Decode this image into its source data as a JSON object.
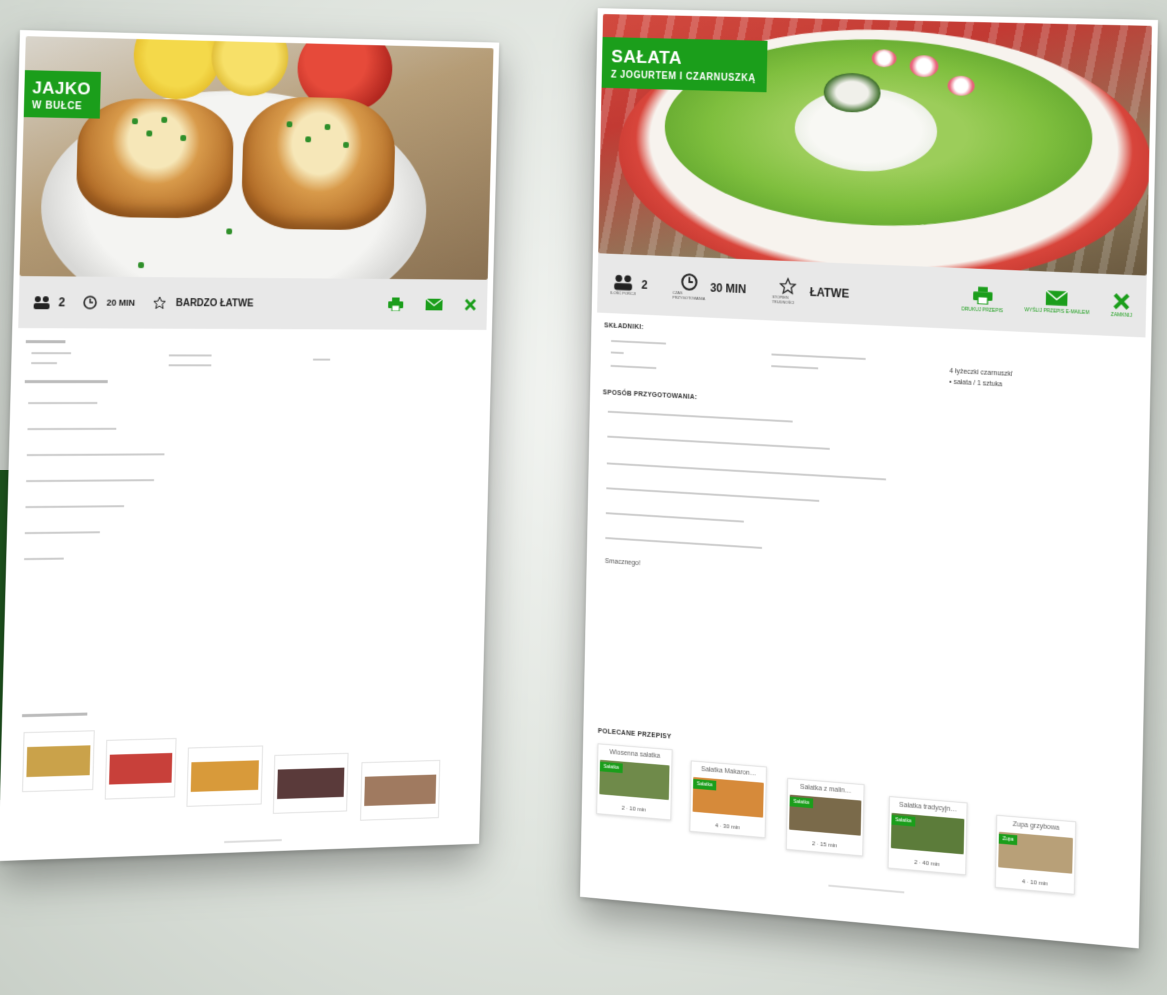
{
  "colors": {
    "accent": "#1b9e1b",
    "toolbar_bg": "#e8e8e8"
  },
  "left": {
    "title_line1": "JAJKO",
    "title_line2": "W BUŁCE",
    "servings": "2",
    "time": "20 MIN",
    "difficulty": "BARDZO ŁATWE"
  },
  "right": {
    "title_line1": "SAŁATA",
    "title_line2": "Z JOGURTEM I CZARNUSZKĄ",
    "servings": "2",
    "time": "30 MIN",
    "difficulty": "ŁATWE",
    "servings_caption": "ILOŚĆ PORCJI",
    "time_caption": "CZAS PRZYGOTOWANIA",
    "difficulty_caption": "STOPIEŃ TRUDNOŚCI",
    "actions": [
      "DRUKUJ PRZEPIS",
      "WYŚLIJ PRZEPIS E-MAILEM",
      "ZAMKNIJ"
    ],
    "ingredients_label": "SKŁADNIKI:",
    "ingredients_col3": [
      "4 łyżeczki czarnuszki",
      "• sałata / 1 sztuka"
    ],
    "method_label": "SPOSÓB PRZYGOTOWANIA:",
    "ending": "Smacznego!",
    "recommended_label": "POLECANE PRZEPISY",
    "recommended": [
      {
        "title": "Wiosenna sałatka",
        "badge": "Sałatka",
        "meta": "2 · 10 min",
        "color": "#6f8a4a"
      },
      {
        "title": "Sałatka Makaron…",
        "badge": "Sałatka",
        "meta": "4 · 30 min",
        "color": "#d68a3a"
      },
      {
        "title": "Sałatka z malin…",
        "badge": "Sałatka",
        "meta": "2 · 15 min",
        "color": "#7a6a4a"
      },
      {
        "title": "Sałatka tradycyjn…",
        "badge": "Sałatka",
        "meta": "2 · 40 min",
        "color": "#5c7c3a"
      },
      {
        "title": "Zupa grzybowa",
        "badge": "Zupa",
        "meta": "4 · 10 min",
        "color": "#b8a078"
      }
    ]
  }
}
